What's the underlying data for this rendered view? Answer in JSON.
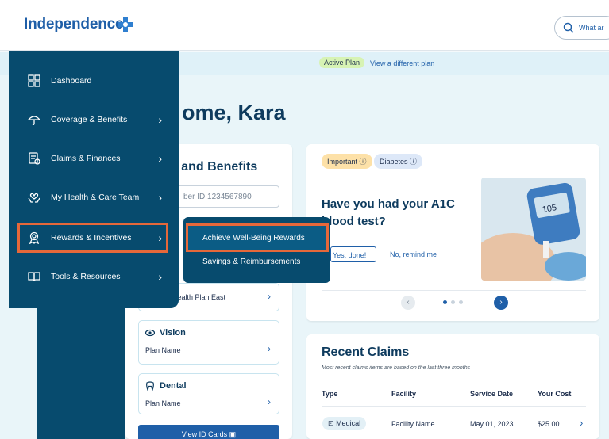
{
  "header": {
    "logo_text": "Independence",
    "search_placeholder": "What ar"
  },
  "plan_bar": {
    "active_plan": "Active Plan",
    "different_plan_link": "View a different plan"
  },
  "welcome": "ome, Kara",
  "plan_card": {
    "title": "n and Benefits",
    "member_id": "ber ID 1234567890",
    "rx_plan": "Health Plan East",
    "vision": {
      "title": "Vision",
      "plan_name": "Plan Name"
    },
    "dental": {
      "title": "Dental",
      "plan_name": "Plan Name"
    },
    "id_cards_button": "View ID Cards"
  },
  "a1c_card": {
    "tags": [
      "Important",
      "Diabetes"
    ],
    "question": "Have you had your A1C blood test?",
    "yes_button": "Yes, done!",
    "remind_link": "No, remind me"
  },
  "claims": {
    "title": "Recent Claims",
    "subtitle": "Most recent claims items are based on the last three months",
    "columns": [
      "Type",
      "Facility",
      "Service Date",
      "Your Cost"
    ],
    "rows": [
      {
        "type": "Medical",
        "facility": "Facility Name",
        "date": "May 01, 2023",
        "cost": "$25.00"
      }
    ]
  },
  "sidenav": {
    "items": [
      {
        "label": "Dashboard",
        "icon": "dashboard-icon"
      },
      {
        "label": "Coverage & Benefits",
        "icon": "umbrella-icon"
      },
      {
        "label": "Claims & Finances",
        "icon": "receipt-icon"
      },
      {
        "label": "My Health & Care Team",
        "icon": "hands-heart-icon"
      },
      {
        "label": "Rewards & Incentives",
        "icon": "award-icon"
      },
      {
        "label": "Tools & Resources",
        "icon": "book-icon"
      }
    ],
    "submenu": [
      "Achieve Well-Being Rewards",
      "Savings & Reimbursements"
    ]
  },
  "colors": {
    "nav_bg": "#074b6e",
    "highlight": "#e5683a",
    "brand_blue": "#1f5fa8"
  }
}
